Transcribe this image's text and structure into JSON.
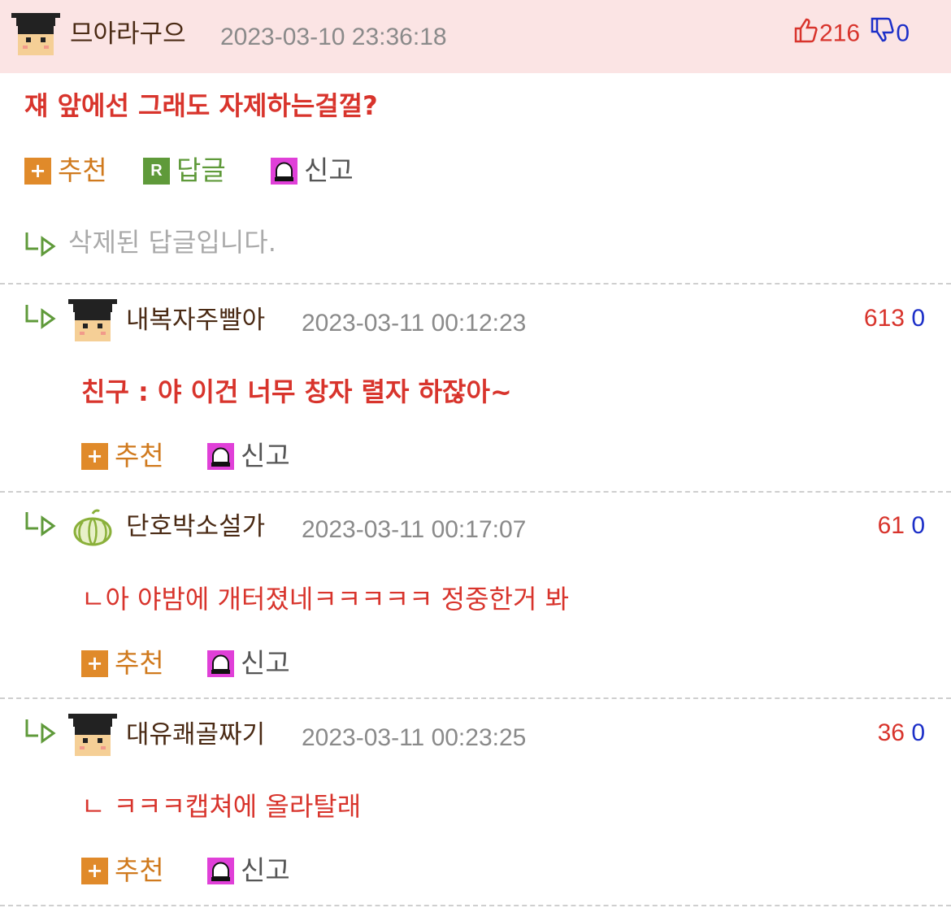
{
  "main_comment": {
    "nickname": "므아라구으",
    "datetime": "2023-03-10 23:36:18",
    "up_votes": "216",
    "down_votes": "0",
    "text": "쟤 앞에선 그래도 자제하는걸껄?",
    "actions": {
      "recommend": "추천",
      "reply": "답글",
      "report": "신고"
    },
    "deleted_reply_text": "삭제된 답글입니다."
  },
  "replies": [
    {
      "nickname": "내복자주빨아",
      "datetime": "2023-03-11 00:12:23",
      "up_votes": "613",
      "down_votes": "0",
      "text": "친구 : 야 이건 너무 창자 렬자 하잖아~",
      "avatar_icon": "student-cap-avatar-icon"
    },
    {
      "nickname": "단호박소설가",
      "datetime": "2023-03-11 00:17:07",
      "up_votes": "61",
      "down_votes": "0",
      "text": "ㄴ아 야밤에 개터졌네ㅋㅋㅋㅋㅋ 정중한거 봐",
      "avatar_icon": "pumpkin-avatar-icon"
    },
    {
      "nickname": "대유쾌골짜기",
      "datetime": "2023-03-11 00:23:25",
      "up_votes": "36",
      "down_votes": "0",
      "text": "ㄴ ㅋㅋㅋ캡쳐에 올라탈래",
      "avatar_icon": "student-cap-avatar-icon"
    }
  ],
  "reply_actions": {
    "recommend": "추천",
    "report": "신고"
  },
  "colors": {
    "highlight_row": "#fbe4e4",
    "up_vote": "#d8342c",
    "down_vote": "#1c2fc8",
    "comment_text": "#d8342c",
    "recommend": "#d07a1e",
    "reply": "#5f9a3a"
  }
}
